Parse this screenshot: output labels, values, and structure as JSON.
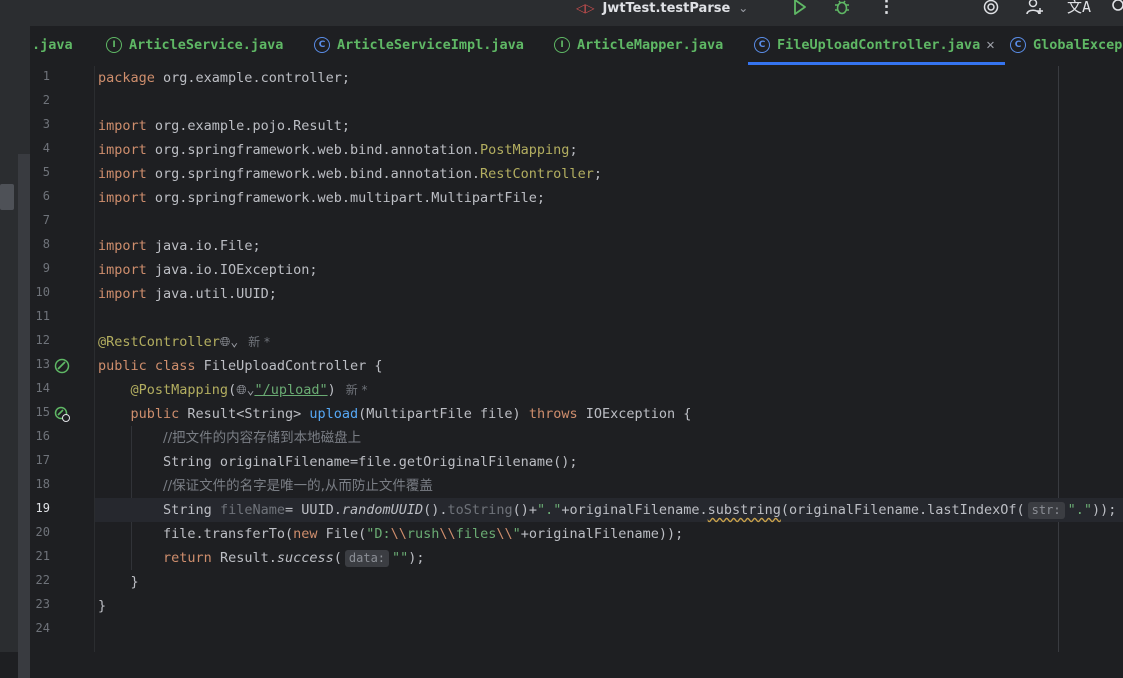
{
  "toolbar": {
    "run_config": "JwtTest.testParse"
  },
  "tabs": [
    {
      "label": ".java",
      "icon": "none"
    },
    {
      "label": "ArticleService.java",
      "icon": "I"
    },
    {
      "label": "ArticleServiceImpl.java",
      "icon": "C"
    },
    {
      "label": "ArticleMapper.java",
      "icon": "I"
    },
    {
      "label": "FileUploadController.java",
      "icon": "C",
      "active": true
    },
    {
      "label": "GlobalExcep",
      "icon": "C"
    }
  ],
  "editor": {
    "line_numbers": [
      "1",
      "2",
      "3",
      "4",
      "5",
      "6",
      "7",
      "8",
      "9",
      "10",
      "11",
      "12",
      "13",
      "14",
      "15",
      "16",
      "17",
      "18",
      "19",
      "20",
      "21",
      "22",
      "23",
      "24"
    ],
    "current_line": "19",
    "code": {
      "l1_kw": "package",
      "l1_rest": " org.example.controller;",
      "import_kw": "import",
      "l3": " org.example.pojo.Result;",
      "l4_pre": " org.springframework.web.bind.annotation.",
      "l4_ann": "PostMapping",
      "l5_pre": " org.springframework.web.bind.annotation.",
      "l5_ann": "RestController",
      "l6": " org.springframework.web.multipart.MultipartFile;",
      "l8": " java.io.File;",
      "l9": " java.io.IOException;",
      "l10": " java.util.UUID;",
      "l12_ann": "@RestController",
      "author_hint": "新 *",
      "l13_kw": "public class",
      "l13_name": " FileUploadController {",
      "l14_ann": "@PostMapping",
      "l14_str": "\"/upload\"",
      "l15_kw": "public",
      "l15_type": " Result<String> ",
      "l15_fn": "upload",
      "l15_params": "(MultipartFile file) ",
      "l15_throws": "throws",
      "l15_rest": " IOException {",
      "l16_cmt": "//把文件的内容存储到本地磁盘上",
      "l17": "String originalFilename=file.getOriginalFilename();",
      "l18_cmt": "//保证文件的名字是唯一的,从而防止文件覆盖",
      "l19_type": "String ",
      "l19_var": "fileName",
      "l19_a": "= UUID.",
      "l19_uuid": "randomUUID",
      "l19_b": "().",
      "l19_tostr": "toString",
      "l19_c": "()+",
      "l19_dot": "\".\"",
      "l19_d": "+originalFilename.",
      "l19_sub": "substring",
      "l19_e": "(originalFilename.lastIndexOf(",
      "l19_hint": "str:",
      "l19_f": "));",
      "l20_a": "file.transferTo(",
      "l20_new": "new",
      "l20_b": " File(",
      "l20_s1": "\"D:",
      "l20_e1": "\\\\",
      "l20_s2": "rush",
      "l20_e2": "\\\\",
      "l20_s3": "files",
      "l20_e3": "\\\\",
      "l20_s4": "\"",
      "l20_c": "+originalFilename));",
      "l21_kw": "return",
      "l21_a": " Result.",
      "l21_fn": "success",
      "l21_b": "(",
      "l21_hint": "data:",
      "l21_str": "\"\"",
      "l21_c": ");",
      "l22": "}",
      "l23": "}"
    }
  },
  "colors": {
    "background": "#1e1f22",
    "keyword": "#cf8e6d",
    "annotation": "#b3ae60",
    "string": "#6aab73",
    "function": "#56a8f5",
    "comment": "#7a7e85",
    "accent": "#3574f0"
  },
  "icons": [
    "build-icon",
    "run-icon",
    "debug-icon",
    "more-icon",
    "ai-assistant-icon",
    "add-user-icon",
    "translate-icon",
    "search-icon",
    "bean-icon",
    "globe-icon"
  ]
}
